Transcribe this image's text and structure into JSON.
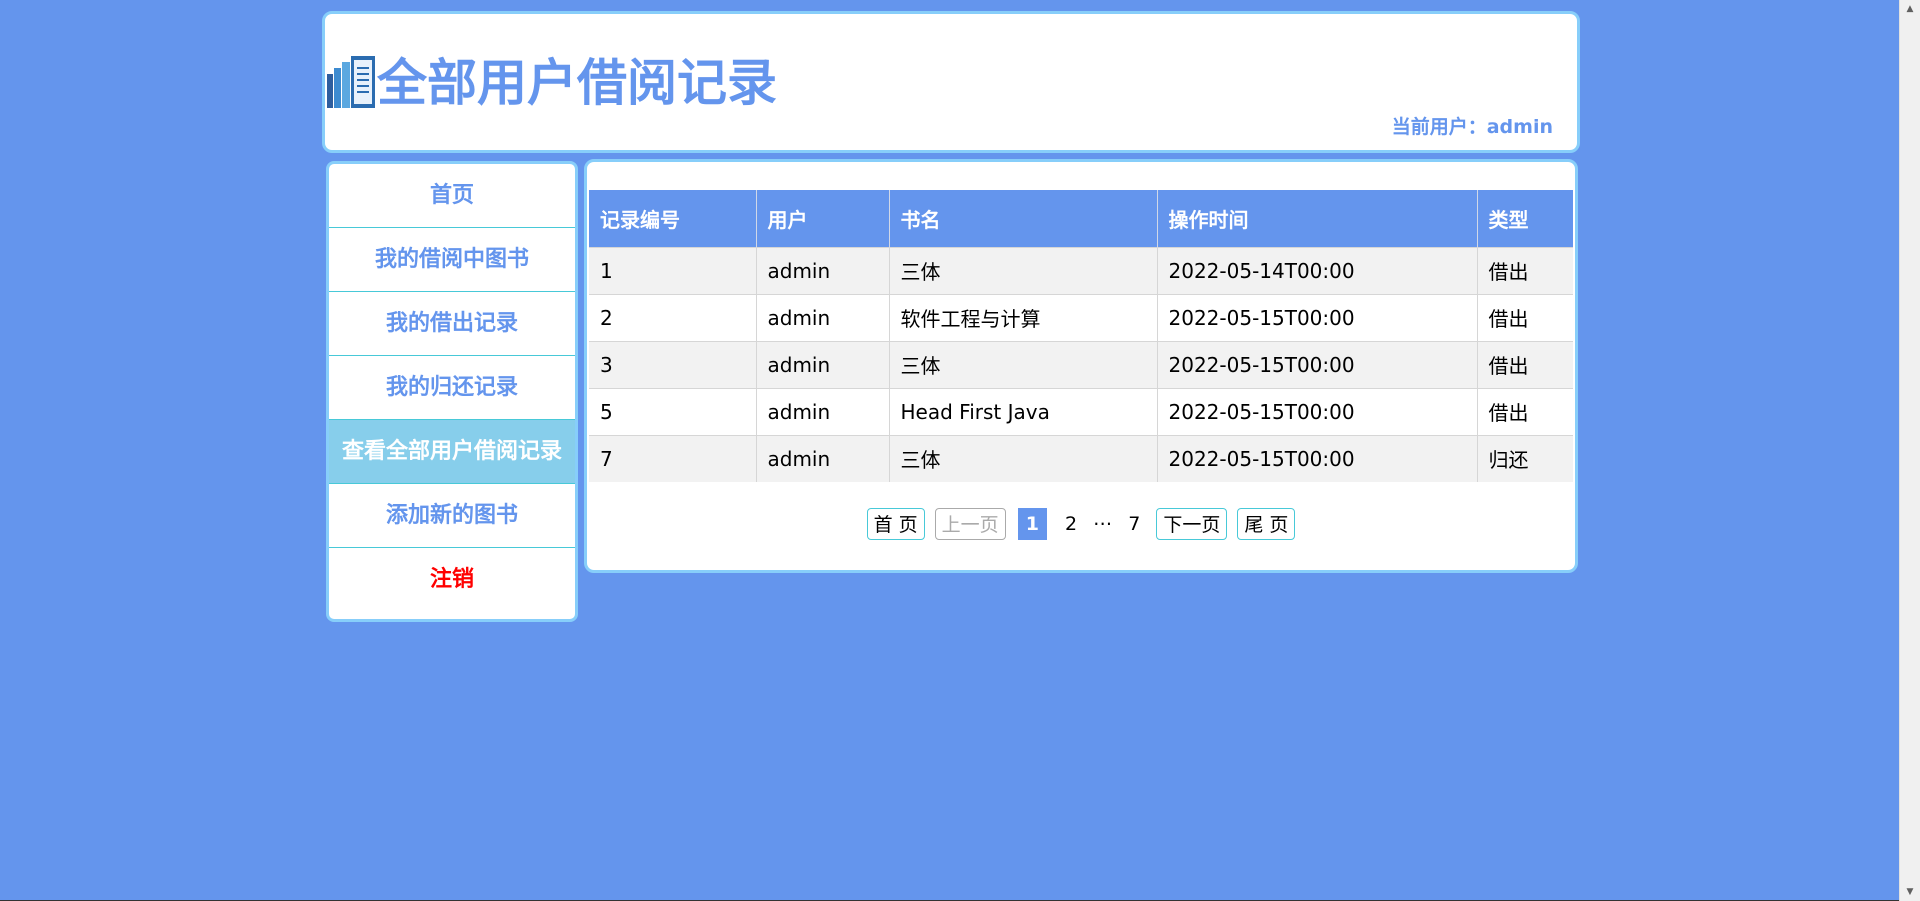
{
  "header": {
    "title": "全部用户借阅记录",
    "current_user_label": "当前用户：admin"
  },
  "sidebar": {
    "items": [
      {
        "label": "首页"
      },
      {
        "label": "我的借阅中图书"
      },
      {
        "label": "我的借出记录"
      },
      {
        "label": "我的归还记录"
      },
      {
        "label": "查看全部用户借阅记录"
      },
      {
        "label": "添加新的图书"
      },
      {
        "label": "注销"
      }
    ],
    "active_index": 4
  },
  "table": {
    "columns": [
      "记录编号",
      "用户",
      "书名",
      "操作时间",
      "类型"
    ],
    "rows": [
      [
        "1",
        "admin",
        "三体",
        "2022-05-14T00:00",
        "借出"
      ],
      [
        "2",
        "admin",
        "软件工程与计算",
        "2022-05-15T00:00",
        "借出"
      ],
      [
        "3",
        "admin",
        "三体",
        "2022-05-15T00:00",
        "借出"
      ],
      [
        "5",
        "admin",
        "Head First Java",
        "2022-05-15T00:00",
        "借出"
      ],
      [
        "7",
        "admin",
        "三体",
        "2022-05-15T00:00",
        "归还"
      ]
    ]
  },
  "pagination": {
    "first": "首 页",
    "prev": "上一页",
    "current": "1",
    "page2": "2",
    "ellipsis": "…",
    "last_page": "7",
    "next": "下一页",
    "last": "尾 页"
  },
  "colors": {
    "background": "#6495ED",
    "accent": "#6495ED",
    "border": "#87CEFA",
    "active_nav": "#87CEEB",
    "logout": "#FF0000"
  },
  "icons": {
    "logo": "library-books-icon"
  }
}
